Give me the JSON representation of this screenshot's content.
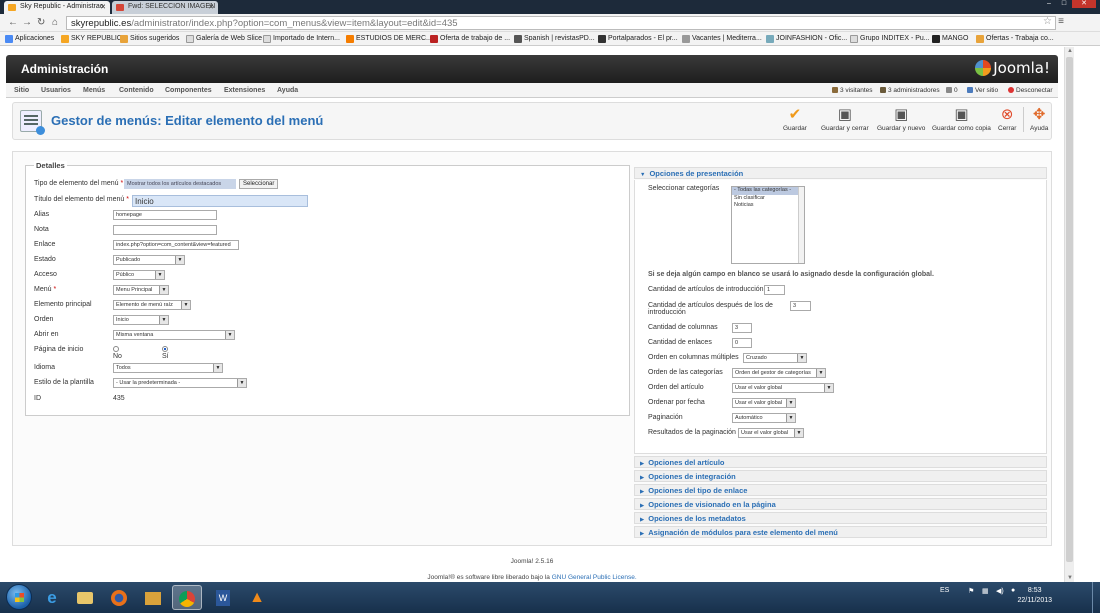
{
  "browser": {
    "tabs": [
      {
        "label": "Sky Republic - Administrac",
        "active": true
      },
      {
        "label": "Fwd: SELECCION IMAGEN",
        "active": false
      }
    ],
    "url_host": "skyrepublic.es",
    "url_path": "/administrator/index.php?option=com_menus&view=item&layout=edit&id=435",
    "bookmarks": [
      "Aplicaciones",
      "SKY REPUBLIC",
      "Sitios sugeridos",
      "Galería de Web Slice",
      "Importado de Intern...",
      "ESTUDIOS DE MERC...",
      "Oferta de trabajo de ...",
      "Spanish | revistasPD...",
      "Portalparados - El pr...",
      "Vacantes | Mediterra...",
      "JOINFASHION - Ofic...",
      "Grupo INDITEX - Pu...",
      "MANGO",
      "Ofertas - Trabaja co..."
    ]
  },
  "admin": {
    "header_title": "Administración",
    "logo_text": "Joomla!",
    "menu": [
      "Sitio",
      "Usuarios",
      "Menús",
      "Contenido",
      "Componentes",
      "Extensiones",
      "Ayuda"
    ],
    "status": {
      "visitors": "3 visitantes",
      "admins": "3 administradores",
      "messages": "0",
      "view_site": "Ver sitio",
      "logout": "Desconectar"
    },
    "page_title": "Gestor de menús: Editar elemento del menú",
    "toolbar": [
      "Guardar",
      "Guardar y cerrar",
      "Guardar y nuevo",
      "Guardar como copia",
      "Cerrar",
      "Ayuda"
    ]
  },
  "details": {
    "legend": "Detalles",
    "fields": {
      "type_label": "Tipo de elemento del menú",
      "type_value": "Mostrar todos los artículos destacados",
      "type_button": "Seleccionar",
      "title_label": "Título del elemento del menú",
      "title_value": "Inicio",
      "alias_label": "Alias",
      "alias_value": "homepage",
      "note_label": "Nota",
      "note_value": "",
      "link_label": "Enlace",
      "link_value": "index.php?option=com_content&view=featured",
      "status_label": "Estado",
      "status_value": "Publicado",
      "access_label": "Acceso",
      "access_value": "Público",
      "menu_label": "Menú",
      "menu_value": "Menu Principal",
      "parent_label": "Elemento principal",
      "parent_value": "Elemento de menú raíz",
      "order_label": "Orden",
      "order_value": "Inicio",
      "open_label": "Abrir en",
      "open_value": "Misma ventana",
      "home_label": "Página de inicio",
      "home_no": "No",
      "home_yes": "Sí",
      "lang_label": "Idioma",
      "lang_value": "Todos",
      "style_label": "Estilo de la plantilla",
      "style_value": "- Usar la predeterminada -",
      "id_label": "ID",
      "id_value": "435"
    }
  },
  "presentation": {
    "title": "Opciones de presentación",
    "categories_label": "Seleccionar categorías",
    "categories": [
      "- Todas las categorías -",
      "Sin clasificar",
      "Noticias"
    ],
    "note": "Si se deja algún campo en blanco se usará lo asignado desde la configuración global.",
    "intro_label": "Cantidad de artículos de introducción",
    "intro_value": "1",
    "after_intro_label_1": "Cantidad de artículos después de los de",
    "after_intro_label_2": "introducción",
    "after_intro_value": "3",
    "columns_label": "Cantidad de columnas",
    "columns_value": "3",
    "links_label": "Cantidad de enlaces",
    "links_value": "0",
    "multi_col_label": "Orden en columnas múltiples",
    "multi_col_value": "Cruzado",
    "cat_order_label": "Orden de las categorías",
    "cat_order_value": "Orden del gestor de categorías",
    "art_order_label": "Orden del artículo",
    "art_order_value": "Usar el valor global",
    "date_order_label": "Ordenar por fecha",
    "date_order_value": "Usar el valor global",
    "pagination_label": "Paginación",
    "pagination_value": "Automático",
    "pag_results_label": "Resultados de la paginación",
    "pag_results_value": "Usar el valor global"
  },
  "panels": [
    "Opciones del artículo",
    "Opciones de integración",
    "Opciones del tipo de enlace",
    "Opciones de visionado en la página",
    "Opciones de los metadatos",
    "Asignación de módulos para este elemento del menú"
  ],
  "footer": {
    "version": "Joomla! 2.5.16",
    "license_prefix": "Joomla!® es software libre liberado bajo la",
    "license_link": "GNU General Public License."
  },
  "taskbar": {
    "lang": "ES",
    "time": "8:53",
    "date": "22/11/2013"
  },
  "colors": {
    "accent": "#2b6fb5",
    "header": "#2a2a2a"
  }
}
